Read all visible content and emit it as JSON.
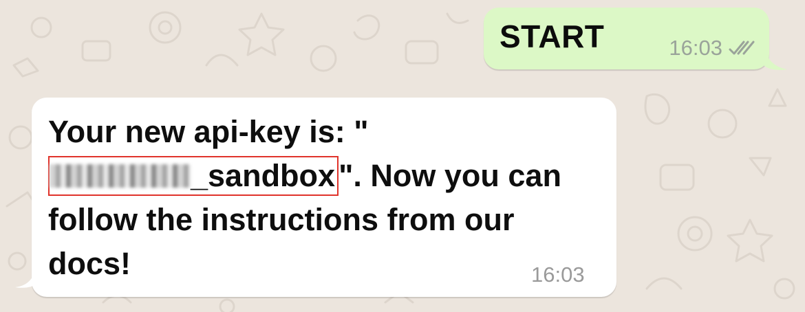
{
  "chat": {
    "outgoing": {
      "text": "START",
      "time": "16:03",
      "status_icon": "double-check-icon"
    },
    "incoming": {
      "text_before": "Your new api-key is: \"",
      "key_redacted_visible": "_sandbox",
      "text_after": "\". Now you can follow the instructions from our docs!",
      "time": "16:03"
    }
  },
  "colors": {
    "wallpaper": "#ece5dd",
    "outgoing_bubble": "#dcf8c6",
    "incoming_bubble": "#ffffff",
    "highlight_box": "#e0332b"
  }
}
